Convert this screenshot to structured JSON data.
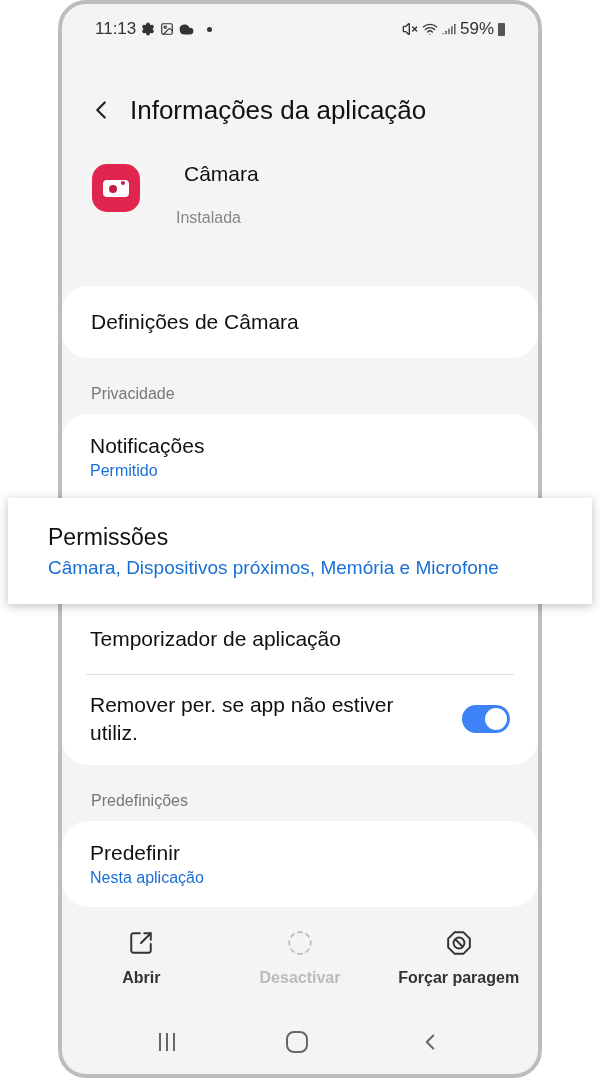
{
  "status_bar": {
    "time": "11:13",
    "battery": "59%"
  },
  "header": {
    "title": "Informações da aplicação"
  },
  "app": {
    "name": "Câmara",
    "status": "Instalada"
  },
  "settings_link": {
    "title": "Definições de Câmara"
  },
  "privacy": {
    "heading": "Privacidade",
    "items": [
      {
        "kind": "link",
        "title": "Notificações",
        "subtitle": "Permitido",
        "highlighted": false
      },
      {
        "kind": "link",
        "title": "Permissões",
        "subtitle": "Câmara, Dispositivos próximos, Memória e Microfone",
        "highlighted": true
      },
      {
        "kind": "link",
        "title": "Temporizador de aplicação",
        "highlighted": false
      },
      {
        "kind": "toggle",
        "title": "Remover per. se app não estiver utiliz.",
        "on": true,
        "highlighted": false
      }
    ]
  },
  "defaults": {
    "heading": "Predefinições",
    "items": [
      {
        "kind": "link",
        "title": "Predefinir",
        "subtitle": "Nesta aplicação",
        "highlighted": false
      }
    ]
  },
  "actions": [
    {
      "kind": "open",
      "label": "Abrir",
      "disabled": false
    },
    {
      "kind": "disable",
      "label": "Desactivar",
      "disabled": true
    },
    {
      "kind": "stop",
      "label": "Forçar paragem",
      "disabled": false
    }
  ]
}
